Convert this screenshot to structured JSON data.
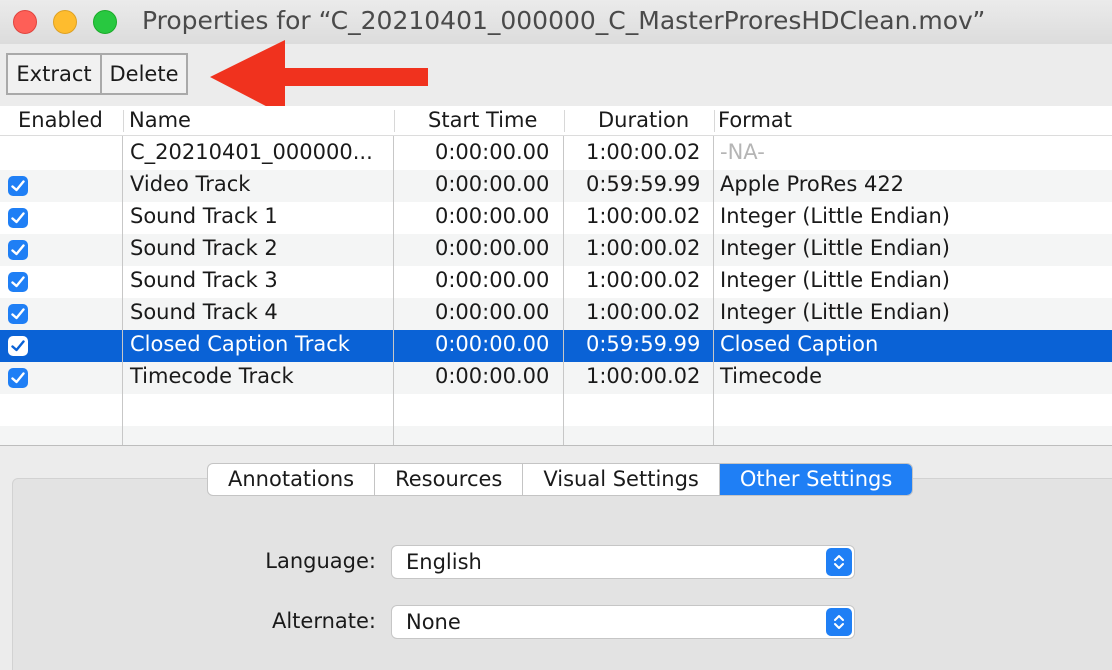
{
  "window": {
    "title": "Properties for “C_20210401_000000_C_MasterProresHDClean.mov”"
  },
  "toolbar": {
    "extract_label": "Extract",
    "delete_label": "Delete"
  },
  "table": {
    "columns": [
      "Enabled",
      "Name",
      "Start Time",
      "Duration",
      "Format"
    ],
    "rows": [
      {
        "enabled": false,
        "name": "C_20210401_000000...",
        "start": "0:00:00.00",
        "duration": "1:00:00.02",
        "format": "-NA-"
      },
      {
        "enabled": true,
        "name": "Video Track",
        "start": "0:00:00.00",
        "duration": "0:59:59.99",
        "format": "Apple ProRes 422"
      },
      {
        "enabled": true,
        "name": "Sound Track 1",
        "start": "0:00:00.00",
        "duration": "1:00:00.02",
        "format": "Integer (Little Endian)"
      },
      {
        "enabled": true,
        "name": "Sound Track 2",
        "start": "0:00:00.00",
        "duration": "1:00:00.02",
        "format": "Integer (Little Endian)"
      },
      {
        "enabled": true,
        "name": "Sound Track 3",
        "start": "0:00:00.00",
        "duration": "1:00:00.02",
        "format": "Integer (Little Endian)"
      },
      {
        "enabled": true,
        "name": "Sound Track 4",
        "start": "0:00:00.00",
        "duration": "1:00:00.02",
        "format": "Integer (Little Endian)"
      },
      {
        "enabled": true,
        "name": "Closed Caption Track",
        "start": "0:00:00.00",
        "duration": "0:59:59.99",
        "format": "Closed Caption",
        "selected": true
      },
      {
        "enabled": true,
        "name": "Timecode Track",
        "start": "0:00:00.00",
        "duration": "1:00:00.02",
        "format": "Timecode"
      }
    ]
  },
  "tabs": [
    {
      "label": "Annotations"
    },
    {
      "label": "Resources"
    },
    {
      "label": "Visual Settings"
    },
    {
      "label": "Other Settings",
      "active": true
    }
  ],
  "settings": {
    "language_label": "Language:",
    "language_value": "English",
    "alternate_label": "Alternate:",
    "alternate_value": "None"
  },
  "colors": {
    "selection": "#0a62d6",
    "accent": "#1f7ff5",
    "annotation_arrow": "#f0321e"
  },
  "icons": {
    "checkbox": "checkmark-icon",
    "popup": "chevron-updown-icon",
    "annotation": "red-arrow-icon"
  }
}
